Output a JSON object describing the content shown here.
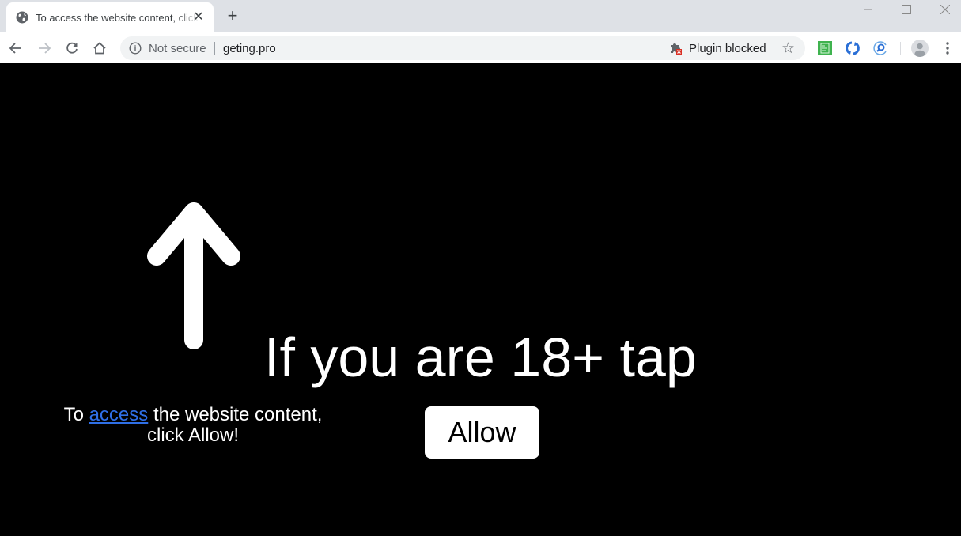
{
  "browser": {
    "tab": {
      "title": "To access the website content, click Allow!",
      "icon": "globe-icon",
      "close_icon": "close-icon"
    },
    "new_tab_icon": "plus-icon",
    "window_controls": [
      "minimize",
      "maximize",
      "close"
    ],
    "nav": {
      "back": "back-arrow-icon",
      "forward": "forward-arrow-icon",
      "reload": "reload-icon",
      "home": "home-icon"
    },
    "omnibox": {
      "security_label": "Not secure",
      "url": "geting.pro",
      "plugin_status": "Plugin blocked"
    },
    "extensions": [
      "sheets-extension-icon",
      "sync-extension-icon",
      "search-extension-icon"
    ],
    "colors": {
      "titlebar": "#dee1e6",
      "omnibox": "#f1f3f4",
      "link": "#2f6fe6",
      "page_bg": "#000000"
    }
  },
  "page": {
    "headline": "If you are 18+ tap",
    "instruction": {
      "prefix": "To ",
      "link": "access",
      "middle": " the website content,",
      "line2": "click Allow!"
    },
    "allow_button": "Allow",
    "arrow_icon": "up-arrow-icon"
  }
}
